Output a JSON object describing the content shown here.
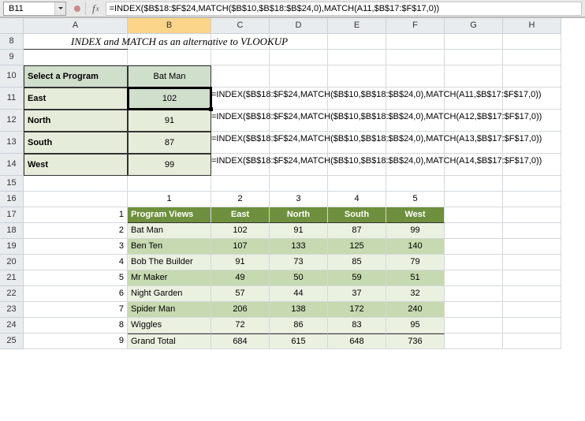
{
  "name_box": "B11",
  "formula_bar": "=INDEX($B$18:$F$24,MATCH($B$10,$B$18:$B$24,0),MATCH(A11,$B$17:$F$17,0))",
  "columns": [
    "A",
    "B",
    "C",
    "D",
    "E",
    "F",
    "G",
    "H"
  ],
  "rows": [
    "8",
    "9",
    "10",
    "11",
    "12",
    "13",
    "14",
    "15",
    "16",
    "17",
    "18",
    "19",
    "20",
    "21",
    "22",
    "23",
    "24",
    "25"
  ],
  "title_row8": "INDEX and MATCH as an alternative to VLOOKUP",
  "block1": {
    "select_label": "Select a Program",
    "program": "Bat Man",
    "rows": [
      {
        "region": "East",
        "value": 102,
        "formula": "=INDEX($B$18:$F$24,MATCH($B$10,$B$18:$B$24,0),MATCH(A11,$B$17:$F$17,0))"
      },
      {
        "region": "North",
        "value": 91,
        "formula": "=INDEX($B$18:$F$24,MATCH($B$10,$B$18:$B$24,0),MATCH(A12,$B$17:$F$17,0))"
      },
      {
        "region": "South",
        "value": 87,
        "formula": "=INDEX($B$18:$F$24,MATCH($B$10,$B$18:$B$24,0),MATCH(A13,$B$17:$F$17,0))"
      },
      {
        "region": "West",
        "value": 99,
        "formula": "=INDEX($B$18:$F$24,MATCH($B$10,$B$18:$B$24,0),MATCH(A14,$B$17:$F$17,0))"
      }
    ]
  },
  "index_cols": [
    "1",
    "2",
    "3",
    "4",
    "5"
  ],
  "index_rows": [
    "1",
    "2",
    "3",
    "4",
    "5",
    "6",
    "7",
    "8",
    "9"
  ],
  "table2": {
    "header": [
      "Program Views",
      "East",
      "North",
      "South",
      "West"
    ],
    "rows": [
      [
        "Bat Man",
        102,
        91,
        87,
        99
      ],
      [
        "Ben Ten",
        107,
        133,
        125,
        140
      ],
      [
        "Bob The Builder",
        91,
        73,
        85,
        79
      ],
      [
        "Mr Maker",
        49,
        50,
        59,
        51
      ],
      [
        "Night Garden",
        57,
        44,
        37,
        32
      ],
      [
        "Spider Man",
        206,
        138,
        172,
        240
      ],
      [
        "Wiggles",
        72,
        86,
        83,
        95
      ]
    ],
    "grand_total": [
      "Grand Total",
      684,
      615,
      648,
      736
    ]
  },
  "chart_data": {
    "type": "table",
    "title": "INDEX and MATCH as an alternative to VLOOKUP",
    "columns": [
      "Program Views",
      "East",
      "North",
      "South",
      "West"
    ],
    "rows": [
      [
        "Bat Man",
        102,
        91,
        87,
        99
      ],
      [
        "Ben Ten",
        107,
        133,
        125,
        140
      ],
      [
        "Bob The Builder",
        91,
        73,
        85,
        79
      ],
      [
        "Mr Maker",
        49,
        50,
        59,
        51
      ],
      [
        "Night Garden",
        57,
        44,
        37,
        32
      ],
      [
        "Spider Man",
        206,
        138,
        172,
        240
      ],
      [
        "Wiggles",
        72,
        86,
        83,
        95
      ],
      [
        "Grand Total",
        684,
        615,
        648,
        736
      ]
    ]
  }
}
